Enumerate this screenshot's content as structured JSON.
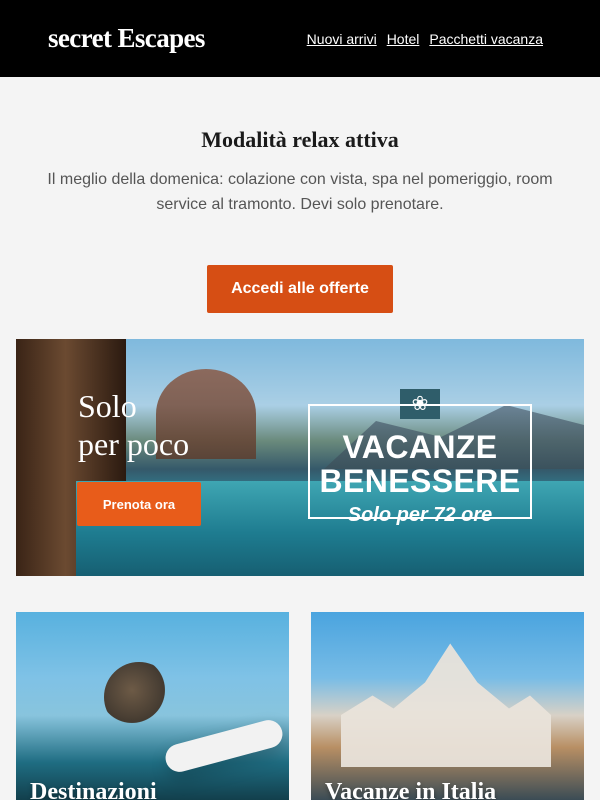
{
  "header": {
    "logo": "secret Escapes",
    "nav": [
      "Nuovi arrivi",
      "Hotel",
      "Pacchetti vacanza"
    ]
  },
  "intro": {
    "title": "Modalità relax attiva",
    "text": "Il meglio della domenica: colazione con vista, spa nel pomeriggio, room service al tramonto. Devi solo prenotare.",
    "cta": "Accedi alle offerte"
  },
  "banner": {
    "headline": "Solo\nper poco",
    "button": "Prenota ora",
    "title": "VACANZE\nBENESSERE",
    "subtitle": "Solo per 72 ore",
    "icon": "lotus-icon"
  },
  "cards": [
    {
      "title": "Destinazioni"
    },
    {
      "title": "Vacanze in Italia"
    }
  ],
  "colors": {
    "header": "#000000",
    "accent": "#d64e14",
    "background": "#f4f4f4"
  }
}
